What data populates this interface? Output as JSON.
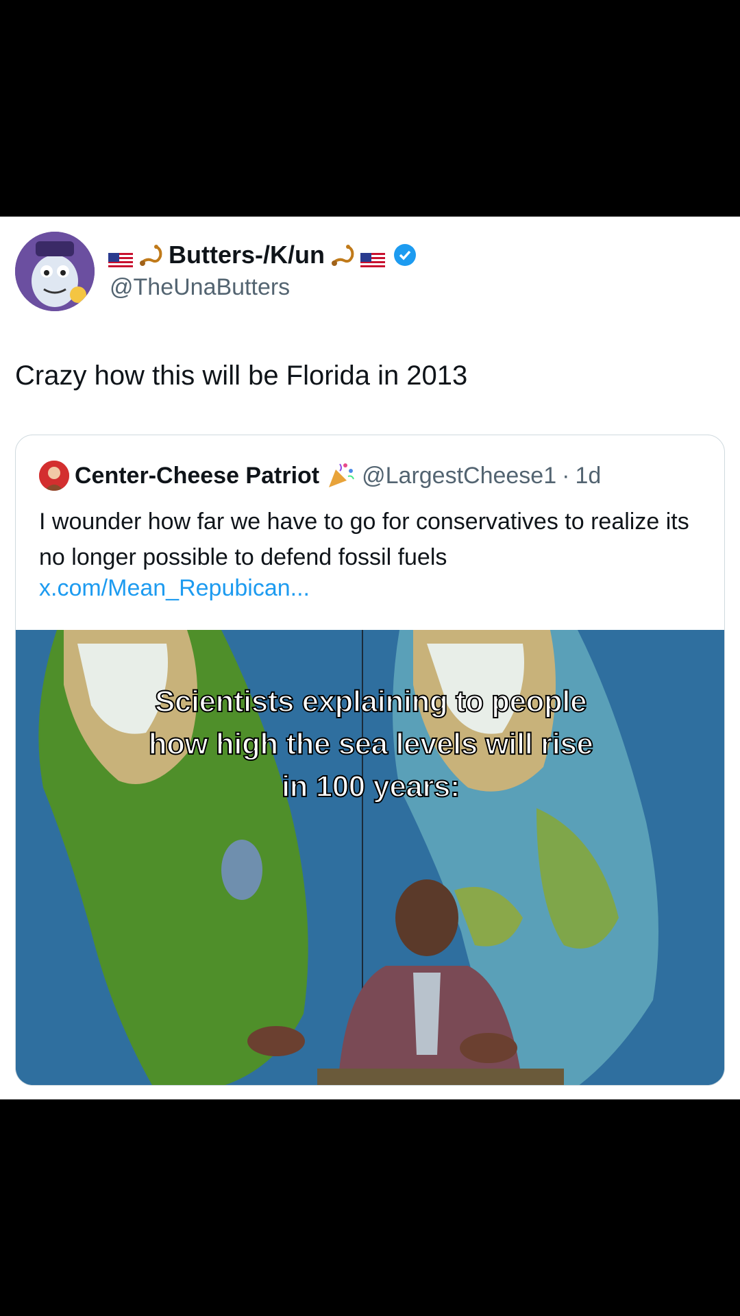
{
  "tweet": {
    "display_name": "Butters-/K/un",
    "handle": "@TheUnaButters",
    "text": "Crazy how this will be Florida in 2013"
  },
  "quote": {
    "display_name": "Center-Cheese Patriot",
    "handle": "@LargestCheese1",
    "separator": "·",
    "time": "1d",
    "text": "I wounder how far we have to go for conservatives to realize its no longer possible to defend fossil fuels",
    "link": "x.com/Mean_Repubican..."
  },
  "media": {
    "caption_lines": [
      "Scientists explaining to people",
      "how high the sea levels will rise",
      "in 100 years:"
    ]
  },
  "colors": {
    "link": "#1d9bf0",
    "verified": "#1d9bf0",
    "secondary_text": "#536471",
    "ocean": "#2f6f9f"
  }
}
